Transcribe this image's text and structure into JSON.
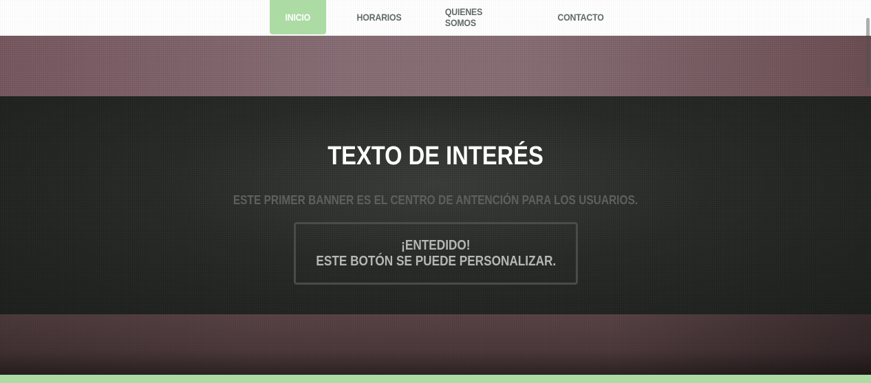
{
  "nav": {
    "items": [
      {
        "label": "INICIO",
        "active": true
      },
      {
        "label": "HORARIOS",
        "active": false
      },
      {
        "label": "QUIENES SOMOS",
        "active": false
      },
      {
        "label": "CONTACTO",
        "active": false
      }
    ]
  },
  "banner": {
    "title": "TEXTO DE INTERÉS",
    "subtitle": "ESTE PRIMER BANNER ES EL CENTRO DE ANTENCIÓN PARA LOS USUARIOS.",
    "button": {
      "line1": "¡ENTEDIDO!",
      "line2": "ESTE BOTÓN SE PUEDE PERSONALIZAR."
    }
  },
  "colors": {
    "accent_green": "#addba4",
    "banner_dark": "#2b2d2a",
    "band_mauve": "#8a7078",
    "band_brown": "#4d3a3c"
  }
}
